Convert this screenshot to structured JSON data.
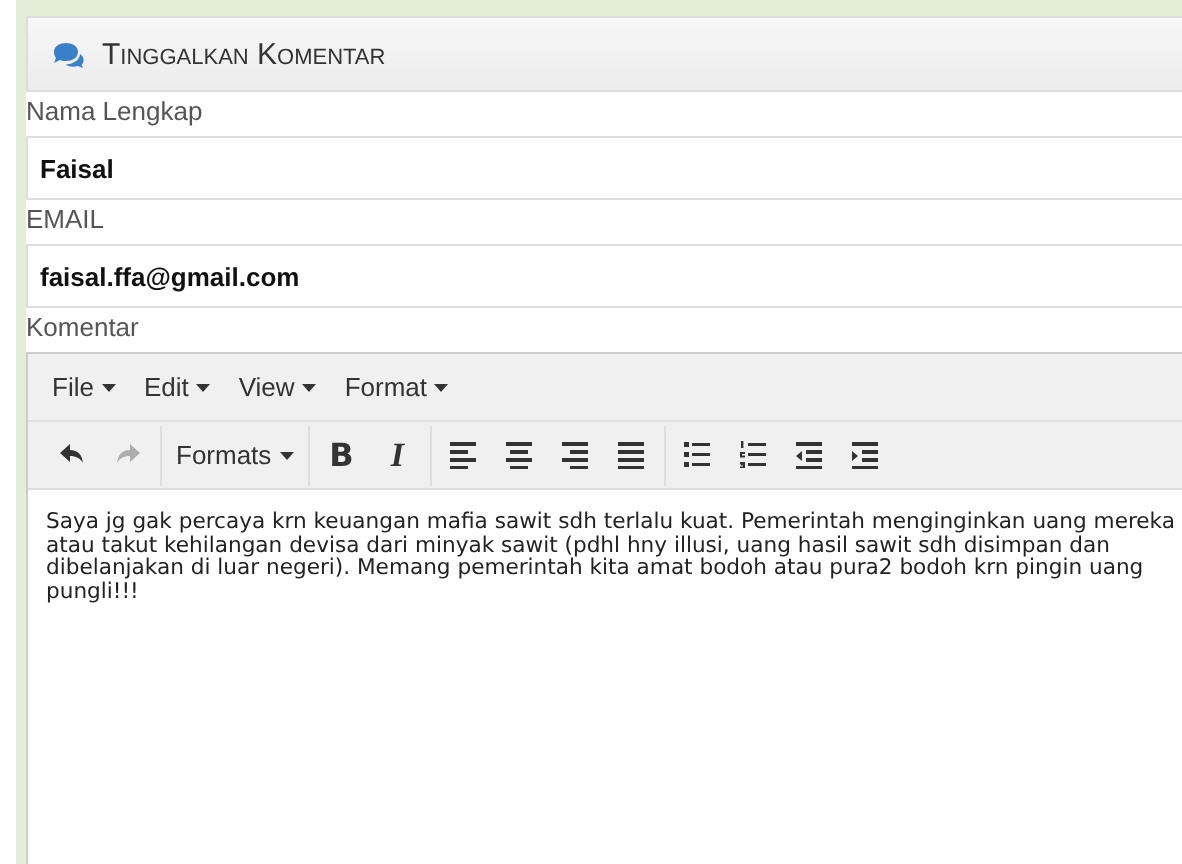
{
  "panel": {
    "title": "Tinggalkan Komentar"
  },
  "fields": [
    {
      "label": "Nama Lengkap",
      "value": "Faisal"
    },
    {
      "label": "EMAIL",
      "value": "faisal.ffa@gmail.com"
    }
  ],
  "editor": {
    "label": "Komentar",
    "menus": [
      "File",
      "Edit",
      "View",
      "Format"
    ],
    "toolbar": [
      [
        {
          "kind": "icon",
          "disabled": false
        },
        {
          "kind": "icon",
          "disabled": true
        }
      ],
      [
        {
          "kind": "dropdown",
          "label": "Formats",
          "disabled": false
        }
      ],
      [
        {
          "kind": "text",
          "label": "B",
          "disabled": false
        },
        {
          "kind": "text",
          "label": "I",
          "disabled": false
        }
      ],
      [
        {
          "kind": "icon",
          "disabled": false
        },
        {
          "kind": "icon",
          "disabled": false
        },
        {
          "kind": "icon",
          "disabled": false
        },
        {
          "kind": "icon",
          "disabled": false
        }
      ],
      [
        {
          "kind": "icon",
          "disabled": false
        },
        {
          "kind": "icon",
          "disabled": false
        },
        {
          "kind": "icon",
          "disabled": false
        },
        {
          "kind": "icon",
          "disabled": false
        }
      ]
    ],
    "content": "Saya jg gak percaya krn keuangan mafia sawit sdh terlalu kuat. Pemerintah menginginkan uang mereka atau takut kehilangan devisa dari minyak sawit (pdhl hny illusi, uang hasil sawit sdh disimpan dan dibelanjakan di luar negeri). Memang pemerintah kita amat bodoh atau pura2 bodoh krn pingin uang pungli!!!"
  }
}
